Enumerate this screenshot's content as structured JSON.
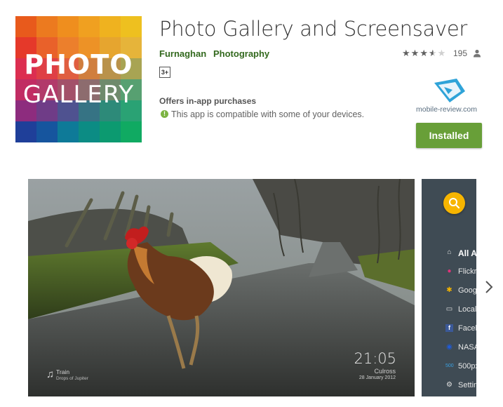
{
  "app": {
    "title": "Photo Gallery and Screensaver",
    "developer": "Furnaghan",
    "category": "Photography",
    "content_rating": "3+",
    "rating_stars": 3.5,
    "review_count": "195",
    "in_app_purchases": "Offers in-app purchases",
    "compatibility": "This app is compatible with some of your devices.",
    "install_label": "Installed",
    "icon": {
      "line1": "PHOTO",
      "line2": "GALLERY"
    }
  },
  "watermark": {
    "text": "mobile-review.com"
  },
  "screenshot1": {
    "time": "21:05",
    "place": "Culross",
    "date": "28 January 2012",
    "track": "Train",
    "artist": "Drops of Jupiter"
  },
  "screenshot2": {
    "menu": [
      {
        "icon": "home-icon",
        "label": "All A"
      },
      {
        "icon": "flickr-icon",
        "label": "Flickr"
      },
      {
        "icon": "google-photos-icon",
        "label": "Googl"
      },
      {
        "icon": "folder-icon",
        "label": "Local"
      },
      {
        "icon": "facebook-icon",
        "label": "Faceb"
      },
      {
        "icon": "nasa-icon",
        "label": "NASA"
      },
      {
        "icon": "500px-icon",
        "label": "500px"
      },
      {
        "icon": "settings-icon",
        "label": "Settin"
      }
    ]
  },
  "colors": {
    "developer_link": "#33691e",
    "install_button": "#689f38",
    "search_fab": "#f7b500",
    "drawer_bg": "#3f4b54"
  }
}
